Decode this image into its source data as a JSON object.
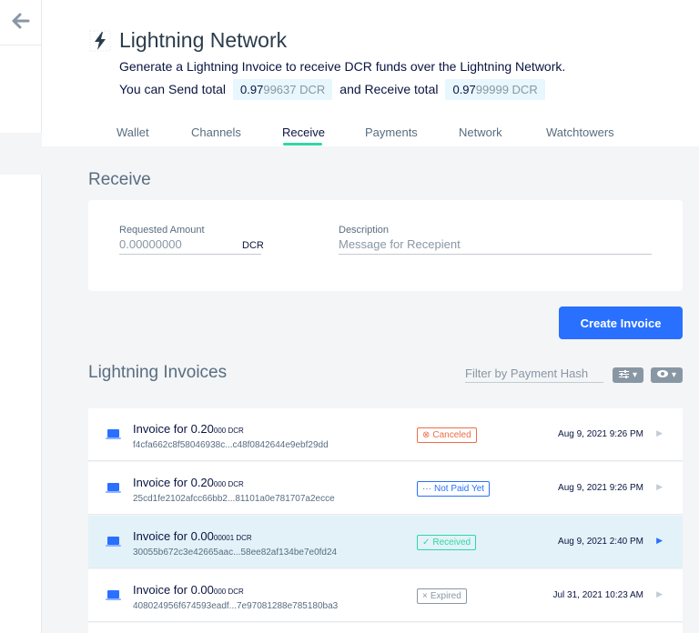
{
  "sidebar": {
    "back_icon": "arrow-left-icon"
  },
  "header": {
    "title": "Lightning Network",
    "subtitle": "Generate a Lightning Invoice to receive DCR funds over the Lightning Network.",
    "send_label": "You can Send total",
    "send_strong": "0.97",
    "send_rest": "99637 DCR",
    "receive_label": "and Receive total",
    "receive_strong": "0.97",
    "receive_rest": "99999 DCR"
  },
  "tabs": [
    {
      "label": "Wallet"
    },
    {
      "label": "Channels"
    },
    {
      "label": "Receive"
    },
    {
      "label": "Payments"
    },
    {
      "label": "Network"
    },
    {
      "label": "Watchtowers"
    }
  ],
  "active_tab": "Receive",
  "receive": {
    "title": "Receive",
    "amount_label": "Requested Amount",
    "amount_placeholder": "0.00000000",
    "amount_unit": "DCR",
    "description_label": "Description",
    "description_placeholder": "Message for Recepient",
    "create_button": "Create Invoice"
  },
  "invoices": {
    "title": "Lightning Invoices",
    "filter_placeholder": "Filter by Payment Hash",
    "items": [
      {
        "title_main": "Invoice for 0.20",
        "title_small": "000 DCR",
        "hash": "f4cfa662c8f58046938c...c48f0842644e9ebf29dd",
        "status": "Canceled",
        "status_icon": "⊗",
        "date": "Aug 9, 2021 9:26 PM"
      },
      {
        "title_main": "Invoice for 0.20",
        "title_small": "000 DCR",
        "hash": "25cd1fe2102afcc66bb2...81101a0e781707a2ecce",
        "status": "Not Paid Yet",
        "status_icon": "···",
        "date": "Aug 9, 2021 9:26 PM"
      },
      {
        "title_main": "Invoice for 0.00",
        "title_small": "00001 DCR",
        "hash": "30055b672c3e42665aac...58ee82af134be7e0fd24",
        "status": "Received",
        "status_icon": "✓",
        "date": "Aug 9, 2021 2:40 PM"
      },
      {
        "title_main": "Invoice for 0.00",
        "title_small": "000 DCR",
        "hash": "408024956f674593eadf...7e97081288e785180ba3",
        "status": "Expired",
        "status_icon": "×",
        "date": "Jul 31, 2021 10:23 AM"
      }
    ]
  },
  "colors": {
    "accent": "#2970ff",
    "tab_underline": "#2ed8a3",
    "canceled": "#ed6d47",
    "received": "#2ed8a3",
    "expired": "#8997a5"
  }
}
